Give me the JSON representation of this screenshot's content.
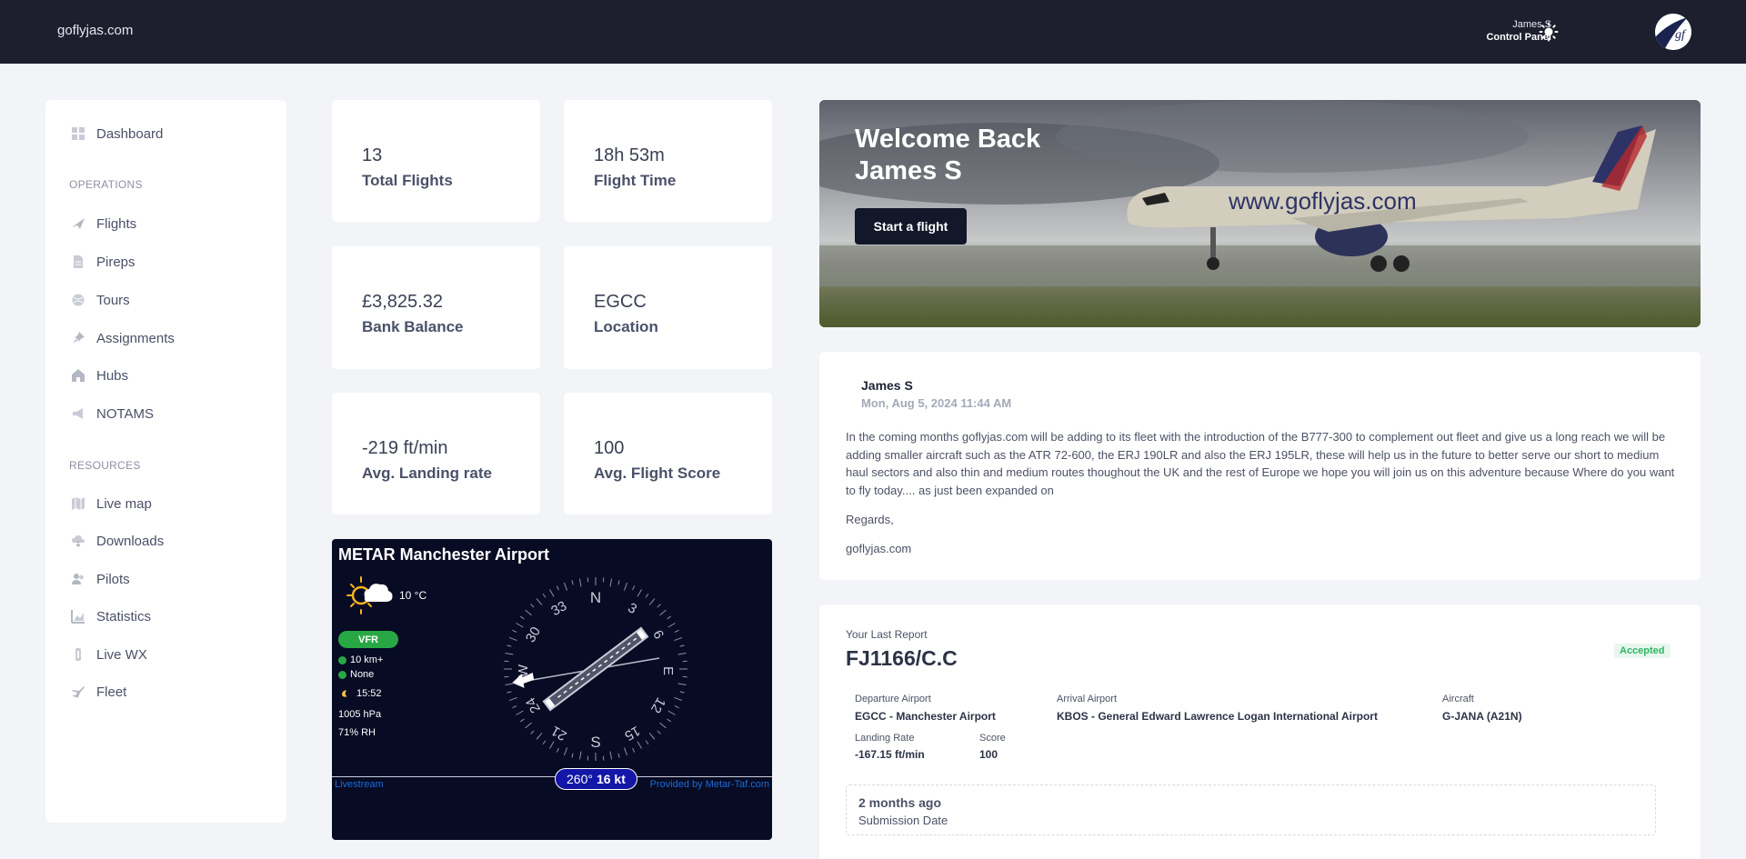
{
  "header": {
    "brand": "goflyjas.com",
    "user_name": "James S",
    "user_link": "Control Panel"
  },
  "sidebar": {
    "dashboard": "Dashboard",
    "operations_label": "OPERATIONS",
    "operations": [
      "Flights",
      "Pireps",
      "Tours",
      "Assignments",
      "Hubs",
      "NOTAMS"
    ],
    "resources_label": "RESOURCES",
    "resources": [
      "Live map",
      "Downloads",
      "Pilots",
      "Statistics",
      "Live WX",
      "Fleet"
    ]
  },
  "stats": [
    {
      "value": "13",
      "label": "Total Flights"
    },
    {
      "value": "18h 53m",
      "label": "Flight Time"
    },
    {
      "value": "£3,825.32",
      "label": "Bank Balance"
    },
    {
      "value": "EGCC",
      "label": "Location"
    },
    {
      "value": "-219 ft/min",
      "label": "Avg. Landing rate"
    },
    {
      "value": "100",
      "label": "Avg. Flight Score"
    }
  ],
  "metar": {
    "title": "METAR Manchester Airport",
    "temperature": "10 °C",
    "flight_rule": "VFR",
    "visibility": "10 km+",
    "weather": "None",
    "time": "15:52",
    "pressure": "1005 hPa",
    "humidity": "71% RH",
    "wind_dir": "260°",
    "wind_speed": "16 kt",
    "livestream": "Livestream",
    "provider": "Provided by Metar-Taf.com",
    "compass_labels": {
      "N": "N",
      "E": "E",
      "S": "S",
      "W": "W",
      "n3": "3",
      "n6": "6",
      "n12": "12",
      "n15": "15",
      "n21": "21",
      "n24": "24",
      "n30": "30",
      "n33": "33"
    }
  },
  "hero": {
    "line1": "Welcome Back",
    "line2": "James S",
    "button": "Start a flight",
    "plane_text": "www.goflyjas.com"
  },
  "news": {
    "author": "James S",
    "date": "Mon, Aug 5, 2024 11:44 AM",
    "body": "In the coming months goflyjas.com will be adding to its fleet with the introduction of the B777-300 to complement out fleet and give us a long reach we will be adding smaller aircraft such as the ATR 72-600, the ERJ 190LR and also the ERJ 195LR, these will help us in the future to better serve our short to medium haul sectors and also thin and medium routes thoughout the UK and the rest of Europe we hope you will join us on this adventure because Where do you want to fly today.... as just been expanded on",
    "regards": "Regards,",
    "signature": "goflyjas.com"
  },
  "report": {
    "kicker": "Your Last Report",
    "flight": "FJ1166/C.C",
    "status": "Accepted",
    "departure_label": "Departure Airport",
    "departure": "EGCC - Manchester Airport",
    "arrival_label": "Arrival Airport",
    "arrival": "KBOS - General Edward Lawrence Logan International Airport",
    "aircraft_label": "Aircraft",
    "aircraft": "G-JANA (A21N)",
    "landing_label": "Landing Rate",
    "landing": "-167.15 ft/min",
    "score_label": "Score",
    "score": "100",
    "submitted": "2 months ago",
    "submitted_label": "Submission Date"
  },
  "colors": {
    "topbar": "#1e1f2e",
    "accepted": "#2fb565",
    "vfr": "#27a844",
    "metar_bg": "#070b24"
  }
}
